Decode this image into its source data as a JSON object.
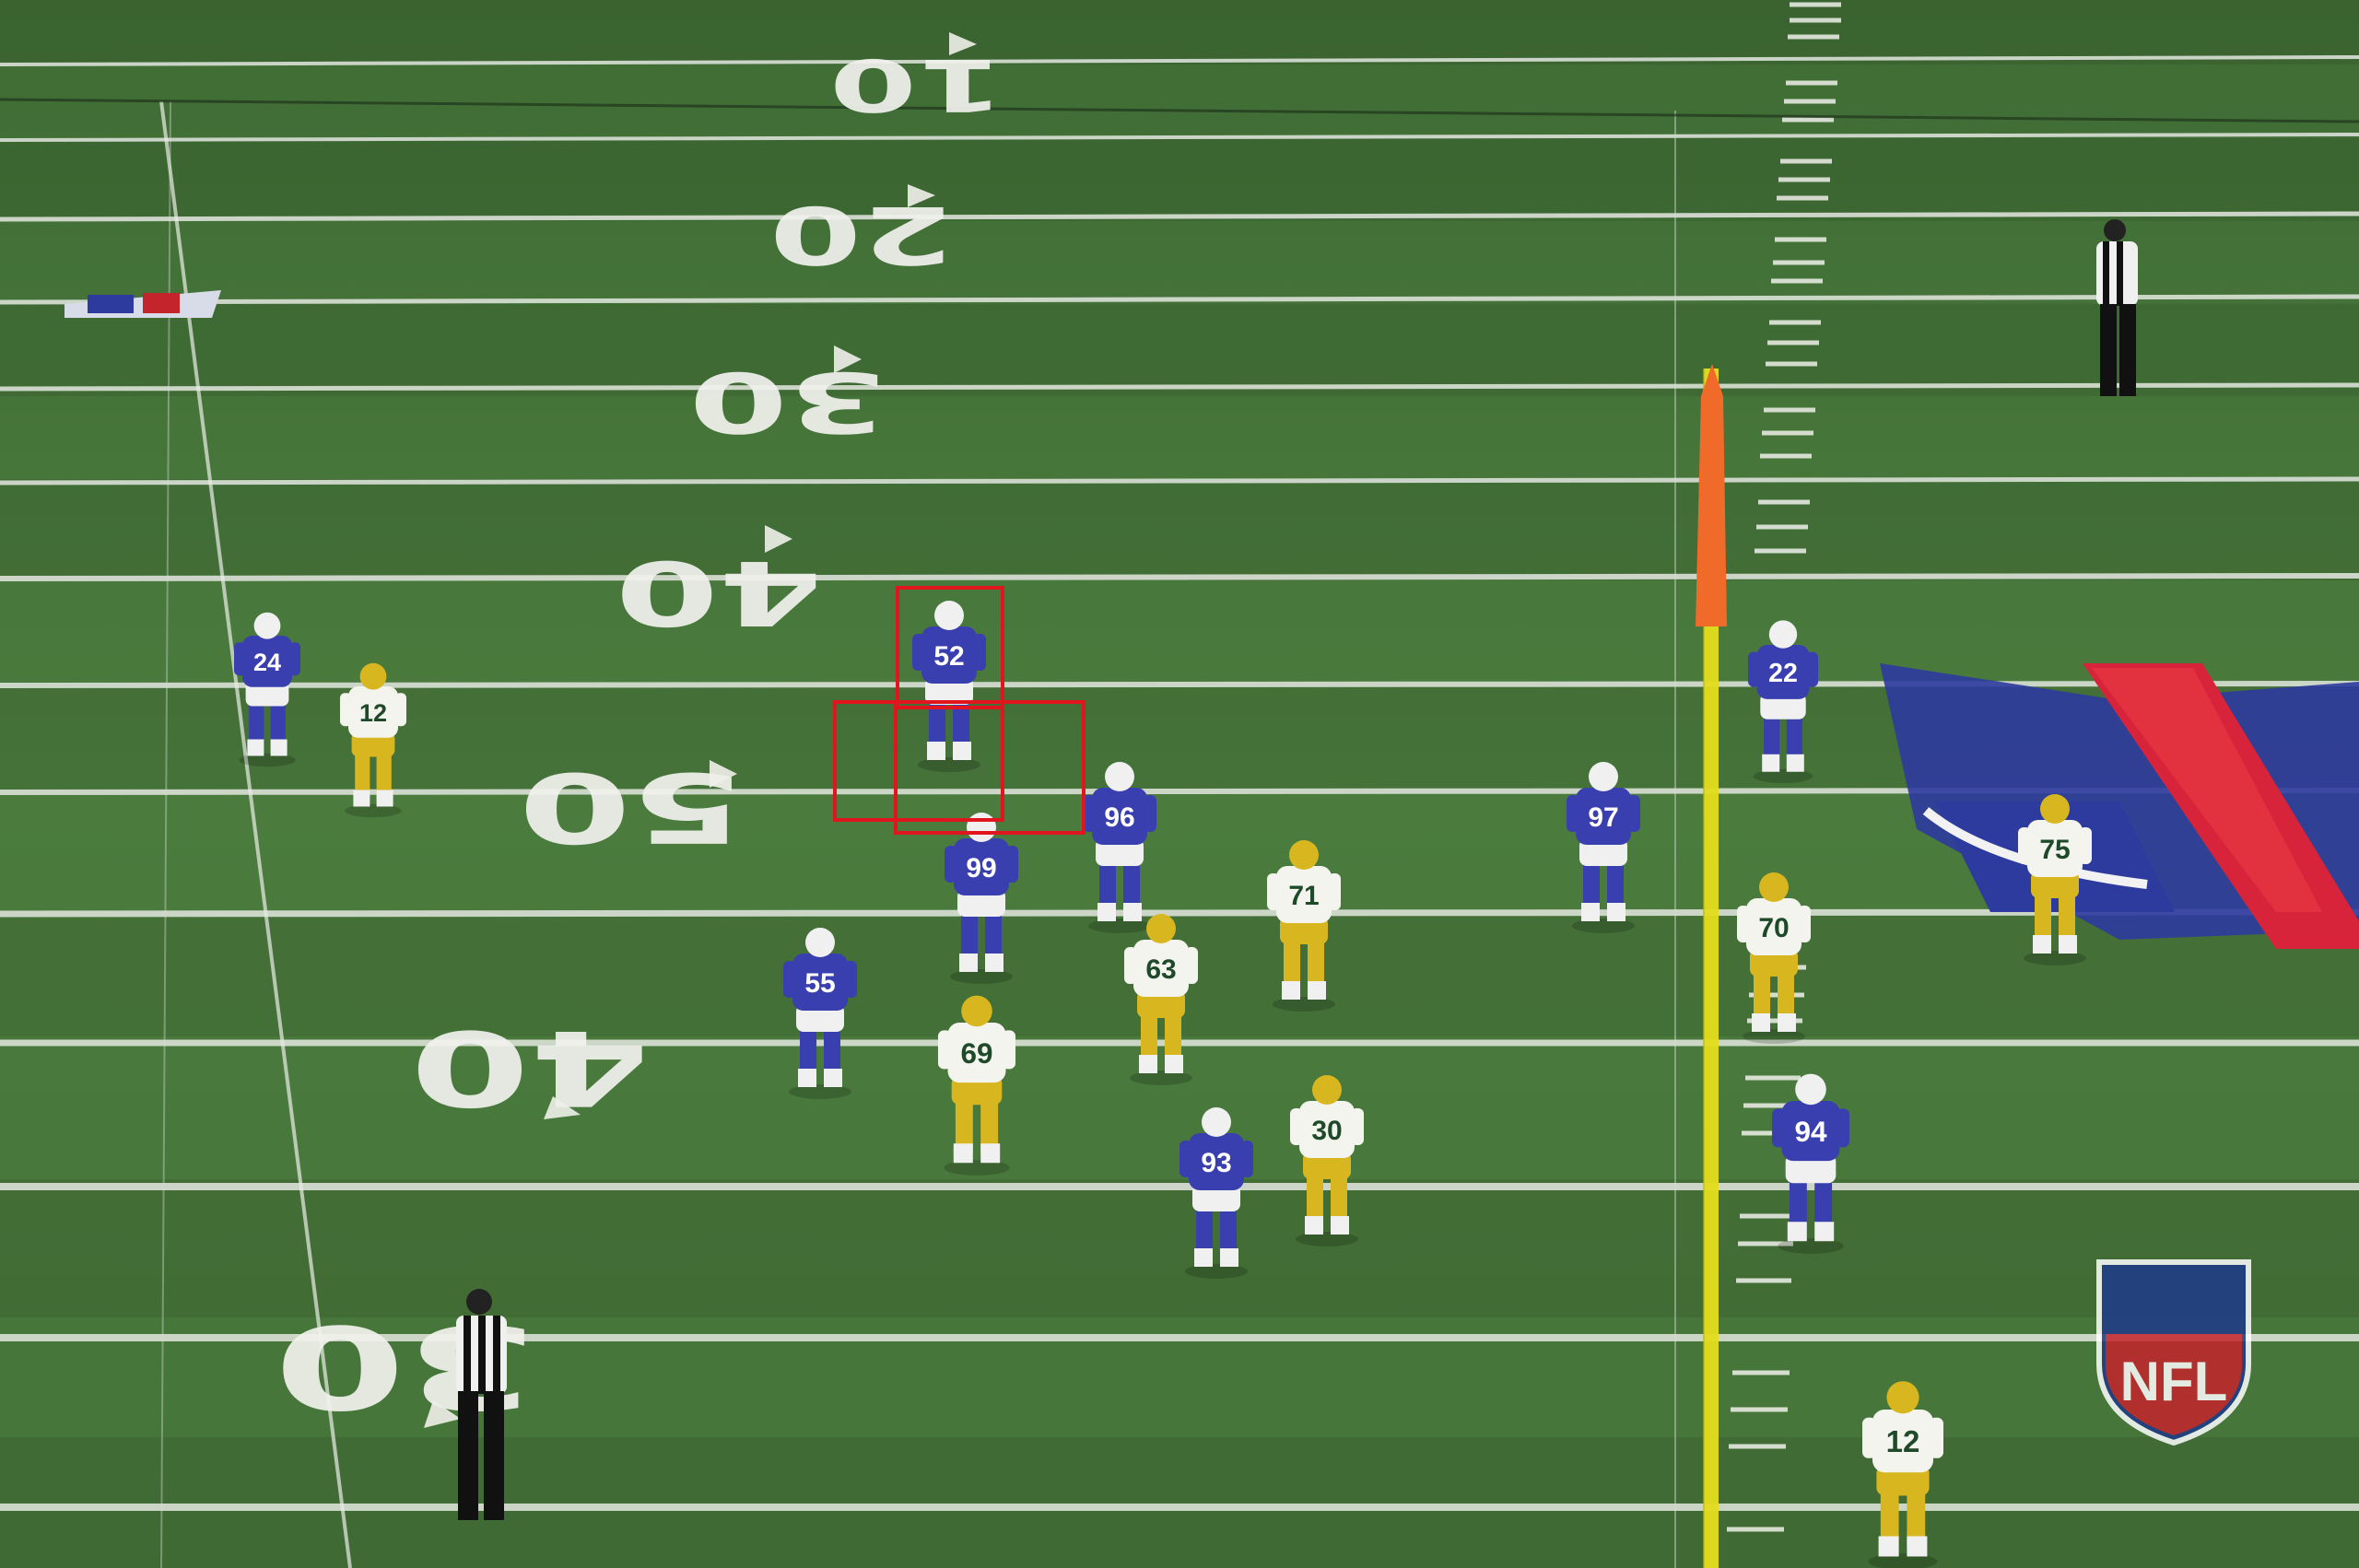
{
  "field": {
    "turf_color": "#4a7a3c",
    "turf_dark": "#3a6530",
    "line_color": "#e9ece6"
  },
  "yard_numbers": [
    {
      "id": "10",
      "text": "10"
    },
    {
      "id": "20",
      "text": "20"
    },
    {
      "id": "30a",
      "text": "30"
    },
    {
      "id": "40a",
      "text": "40"
    },
    {
      "id": "50",
      "text": "50"
    },
    {
      "id": "40b",
      "text": "40"
    },
    {
      "id": "30b",
      "text": "30"
    }
  ],
  "teams": {
    "bills": {
      "jersey": "#3a3fb0",
      "helmet": "#f0f0f0",
      "pants": "#f0f0f0"
    },
    "packers": {
      "jersey": "#f4f4ef",
      "helmet": "#d8b620",
      "pants": "#d8b620"
    }
  },
  "players": [
    {
      "team": "bills",
      "number": "52"
    },
    {
      "team": "bills",
      "number": "99"
    },
    {
      "team": "bills",
      "number": "96"
    },
    {
      "team": "bills",
      "number": "55"
    },
    {
      "team": "bills",
      "number": "97"
    },
    {
      "team": "bills",
      "number": "94"
    },
    {
      "team": "bills",
      "number": "93"
    },
    {
      "team": "bills",
      "number": "24"
    },
    {
      "team": "bills",
      "number": "22"
    },
    {
      "team": "packers",
      "number": "12"
    },
    {
      "team": "packers",
      "number": "12"
    },
    {
      "team": "packers",
      "number": "71"
    },
    {
      "team": "packers",
      "number": "63"
    },
    {
      "team": "packers",
      "number": "69"
    },
    {
      "team": "packers",
      "number": "30"
    },
    {
      "team": "packers",
      "number": "70"
    },
    {
      "team": "packers",
      "number": "75"
    }
  ],
  "annotations": {
    "highlight_color": "#e0151d"
  },
  "watermark": {
    "text": "NFL",
    "shield_blue": "#1d3a8a",
    "shield_red": "#c4242b"
  },
  "first_down_pylon_color": "#f06a2a",
  "yellow_line_color": "#e8e020"
}
